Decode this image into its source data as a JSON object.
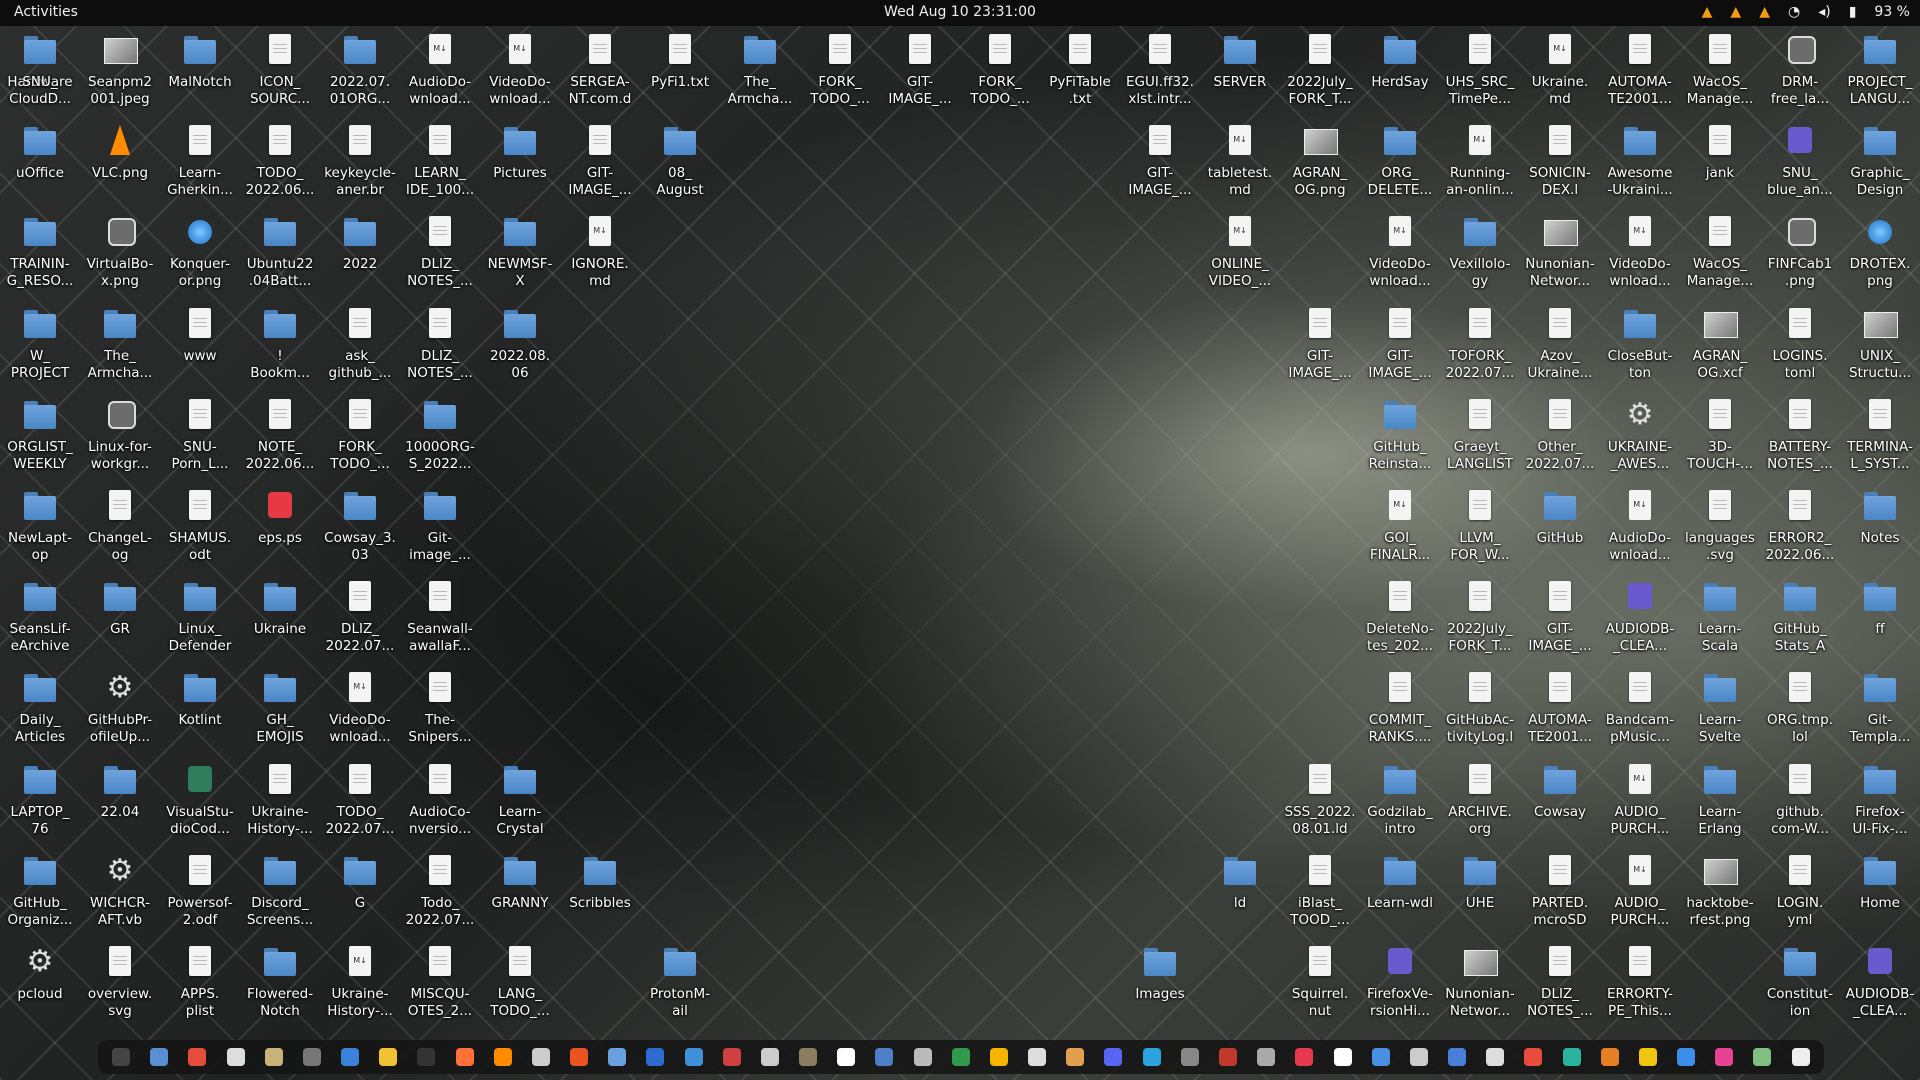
{
  "topbar": {
    "activities": "Activities",
    "clock": "Wed Aug 10  23:31:00",
    "battery": "93 %"
  },
  "desktop_icons": [
    {
      "label": "Hardware",
      "type": "folder"
    },
    {
      "label": "Seanpm2\n001.jpeg",
      "type": "image"
    },
    {
      "label": "MalNotch",
      "type": "folder"
    },
    {
      "label": "ICON_\nSOURC...",
      "type": "doc"
    },
    {
      "label": "2022.07.\n01ORG...",
      "type": "folder"
    },
    {
      "label": "AudioDo-\nwnload...",
      "type": "md"
    },
    {
      "label": "VideoDo-\nwnload...",
      "type": "md"
    },
    {
      "label": "SERGEA-\nNT.com.d",
      "type": "doc"
    },
    {
      "label": "PyFi1.txt",
      "type": "doc"
    },
    {
      "label": "The_\nArmcha...",
      "type": "folder"
    },
    {
      "label": "FORK_\nTODO_...",
      "type": "doc"
    },
    {
      "label": "GIT-\nIMAGE_...",
      "type": "doc"
    },
    {
      "label": "FORK_\nTODO_...",
      "type": "doc"
    },
    {
      "label": "PyFiTable\n.txt",
      "type": "doc"
    },
    {
      "label": "EGUI.ff32.\nxlst.intr...",
      "type": "doc"
    },
    {
      "label": "SERVER",
      "type": "folder"
    },
    {
      "label": "2022July_\nFORK_T...",
      "type": "doc"
    },
    {
      "label": "HerdSay",
      "type": "folder"
    },
    {
      "label": "UHS_SRC_\nTimePe...",
      "type": "doc"
    },
    {
      "label": "Ukraine.\nmd",
      "type": "md"
    },
    {
      "label": "AUTOMA-\nTE2001...",
      "type": "doc"
    },
    {
      "label": "WacOS_\nManage...",
      "type": "doc"
    },
    {
      "label": "DRM-\nfree_la...",
      "type": "app"
    },
    {
      "label": "PROJECT_\nLANGU...",
      "type": "folder"
    },
    {
      "label": "uOffice",
      "type": "folder"
    },
    {
      "label": "VLC.png",
      "type": "cone"
    },
    {
      "label": "Learn-\nGherkin...",
      "type": "doc"
    },
    {
      "label": "TODO_\n2022.06...",
      "type": "doc"
    },
    {
      "label": "keykeycle-\naner.br",
      "type": "doc"
    },
    {
      "label": "LEARN_\nIDE_100...",
      "type": "doc"
    },
    {
      "label": "Pictures",
      "type": "folder"
    },
    {
      "label": "GIT-\nIMAGE_...",
      "type": "doc"
    },
    {
      "label": "08_\nAugust",
      "type": "folder"
    },
    {
      "label": "GIT-\nIMAGE_...",
      "type": "doc"
    },
    {
      "label": "tabletest.\nmd",
      "type": "md"
    },
    {
      "label": "AGRAN_\nOG.png",
      "type": "image"
    },
    {
      "label": "ORG_\nDELETE...",
      "type": "folder"
    },
    {
      "label": "Running-\nan-onlin...",
      "type": "md"
    },
    {
      "label": "SONICIN-\nDEX.l",
      "type": "doc"
    },
    {
      "label": "Awesome\n-Ukraini...",
      "type": "folder"
    },
    {
      "label": "jank",
      "type": "doc"
    },
    {
      "label": "SNU_\nblue_an...",
      "type": "purple"
    },
    {
      "label": "Graphic_\nDesign",
      "type": "folder"
    },
    {
      "label": "TRAININ-\nG_RESO...",
      "type": "folder"
    },
    {
      "label": "VirtualBo-\nx.png",
      "type": "app"
    },
    {
      "label": "Konquer-\nor.png",
      "type": "web"
    },
    {
      "label": "Ubuntu22\n.04Batt...",
      "type": "folder"
    },
    {
      "label": "2022",
      "type": "folder"
    },
    {
      "label": "DLIZ_\nNOTES_...",
      "type": "doc"
    },
    {
      "label": "NEWMSF-\nX",
      "type": "folder"
    },
    {
      "label": "IGNORE.\nmd",
      "type": "md"
    },
    {
      "label": "ONLINE_\nVIDEO_...",
      "type": "md"
    },
    {
      "label": "VideoDo-\nwnload...",
      "type": "md"
    },
    {
      "label": "Vexillolo-\ngy",
      "type": "folder"
    },
    {
      "label": "Nunonian-\nNetwor...",
      "type": "image"
    },
    {
      "label": "VideoDo-\nwnload...",
      "type": "md"
    },
    {
      "label": "WacOS_\nManage...",
      "type": "doc"
    },
    {
      "label": "FINFCab1\n.png",
      "type": "app"
    },
    {
      "label": "DROTEX.\npng",
      "type": "web"
    },
    {
      "label": "W_\nPROJECT",
      "type": "folder"
    },
    {
      "label": "The_\nArmcha...",
      "type": "folder"
    },
    {
      "label": "www",
      "type": "doc"
    },
    {
      "label": "!\nBookm...",
      "type": "folder"
    },
    {
      "label": "ask_\ngithub_...",
      "type": "doc"
    },
    {
      "label": "DLIZ_\nNOTES_...",
      "type": "doc"
    },
    {
      "label": "2022.08.\n06",
      "type": "folder"
    },
    {
      "label": "GIT-\nIMAGE_...",
      "type": "doc"
    },
    {
      "label": "GIT-\nIMAGE_...",
      "type": "doc"
    },
    {
      "label": "TOFORK_\n2022.07...",
      "type": "doc"
    },
    {
      "label": "Azov_\nUkraine...",
      "type": "doc"
    },
    {
      "label": "CloseBut-\nton",
      "type": "folder"
    },
    {
      "label": "AGRAN_\nOG.xcf",
      "type": "image"
    },
    {
      "label": "LOGINS.\ntoml",
      "type": "doc"
    },
    {
      "label": "UNIX_\nStructu...",
      "type": "image"
    },
    {
      "label": "ORGLIST_\nWEEKLY",
      "type": "folder"
    },
    {
      "label": "Linux-for-\nworkgr...",
      "type": "app"
    },
    {
      "label": "SNU-\nPorn_L...",
      "type": "doc"
    },
    {
      "label": "NOTE_\n2022.06...",
      "type": "doc"
    },
    {
      "label": "FORK_\nTODO_...",
      "type": "doc"
    },
    {
      "label": "1000ORG-\nS_2022...",
      "type": "folder"
    },
    {
      "label": "GitHub_\nReinsta...",
      "type": "folder"
    },
    {
      "label": "Graeyt_\nLANGLIST",
      "type": "doc"
    },
    {
      "label": "Other_\n2022.07...",
      "type": "doc"
    },
    {
      "label": "UKRAINE-\n_AWES...",
      "type": "gear"
    },
    {
      "label": "3D-\nTOUCH-...",
      "type": "doc"
    },
    {
      "label": "BATTERY-\nNOTES_...",
      "type": "doc"
    },
    {
      "label": "TERMINA-\nL_SYST...",
      "type": "doc"
    },
    {
      "label": "NewLapt-\nop",
      "type": "folder"
    },
    {
      "label": "ChangeL-\nog",
      "type": "doc"
    },
    {
      "label": "SHAMUS.\nodt",
      "type": "doc"
    },
    {
      "label": "eps.ps",
      "type": "red"
    },
    {
      "label": "Cowsay_3.\n03",
      "type": "folder"
    },
    {
      "label": "Git-\nimage_...",
      "type": "folder"
    },
    {
      "label": "GOI_\nFINALR...",
      "type": "md"
    },
    {
      "label": "LLVM_\nFOR_W...",
      "type": "doc"
    },
    {
      "label": "GitHub",
      "type": "folder"
    },
    {
      "label": "AudioDo-\nwnload...",
      "type": "md"
    },
    {
      "label": "languages\n.svg",
      "type": "doc"
    },
    {
      "label": "ERROR2_\n2022.06...",
      "type": "doc"
    },
    {
      "label": "Notes",
      "type": "folder"
    },
    {
      "label": "SeansLif-\neArchive",
      "type": "folder"
    },
    {
      "label": "GR",
      "type": "folder"
    },
    {
      "label": "Linux_\nDefender",
      "type": "folder"
    },
    {
      "label": "Ukraine",
      "type": "folder"
    },
    {
      "label": "DLIZ_\n2022.07...",
      "type": "doc"
    },
    {
      "label": "Seanwall-\nawallaF...",
      "type": "doc"
    },
    {
      "label": "DeleteNo-\ntes_202...",
      "type": "doc"
    },
    {
      "label": "2022July_\nFORK_T...",
      "type": "doc"
    },
    {
      "label": "GIT-\nIMAGE_...",
      "type": "doc"
    },
    {
      "label": "AUDIODB-\n_CLEA...",
      "type": "purple"
    },
    {
      "label": "Learn-\nScala",
      "type": "folder"
    },
    {
      "label": "GitHub_\nStats_A",
      "type": "folder"
    },
    {
      "label": "ff",
      "type": "folder"
    },
    {
      "label": "Daily_\nArticles",
      "type": "folder"
    },
    {
      "label": "GitHubPr-\nofileUp...",
      "type": "gear"
    },
    {
      "label": "Kotlint",
      "type": "folder"
    },
    {
      "label": "GH_\nEMOJIS",
      "type": "folder"
    },
    {
      "label": "VideoDo-\nwnload...",
      "type": "md"
    },
    {
      "label": "The-\nSnipers...",
      "type": "doc"
    },
    {
      "label": "COMMIT_\nRANKS....",
      "type": "doc"
    },
    {
      "label": "GitHubAc-\ntivityLog.l",
      "type": "doc"
    },
    {
      "label": "AUTOMA-\nTE2001...",
      "type": "doc"
    },
    {
      "label": "Bandcam-\npMusic...",
      "type": "doc"
    },
    {
      "label": "Learn-\nSvelte",
      "type": "folder"
    },
    {
      "label": "ORG.tmp.\nlol",
      "type": "doc"
    },
    {
      "label": "Git-\nTempla...",
      "type": "folder"
    },
    {
      "label": "LAPTOP_\n76",
      "type": "folder"
    },
    {
      "label": "22.04",
      "type": "folder"
    },
    {
      "label": "VisualStu-\ndioCod...",
      "type": "green"
    },
    {
      "label": "Ukraine-\nHistory-...",
      "type": "doc"
    },
    {
      "label": "TODO_\n2022.07...",
      "type": "doc"
    },
    {
      "label": "AudioCo-\nnversio...",
      "type": "doc"
    },
    {
      "label": "Learn-\nCrystal",
      "type": "folder"
    },
    {
      "label": "SSS_2022.\n08.01.ld",
      "type": "doc"
    },
    {
      "label": "Godzilab_\nintro",
      "type": "folder"
    },
    {
      "label": "ARCHIVE.\norg",
      "type": "doc"
    },
    {
      "label": "Cowsay",
      "type": "folder"
    },
    {
      "label": "AUDIO_\nPURCH...",
      "type": "md"
    },
    {
      "label": "Learn-\nErlang",
      "type": "folder"
    },
    {
      "label": "github.\ncom-W...",
      "type": "doc"
    },
    {
      "label": "Firefox-\nUI-Fix-...",
      "type": "folder"
    },
    {
      "label": "GitHub_\nOrganiz...",
      "type": "folder"
    },
    {
      "label": "WICHCR-\nAFT.vb",
      "type": "gear"
    },
    {
      "label": "Powersof-\n2.odf",
      "type": "doc"
    },
    {
      "label": "Discord_\nScreens...",
      "type": "folder"
    },
    {
      "label": "G",
      "type": "folder"
    },
    {
      "label": "Todo_\n2022.07...",
      "type": "doc"
    },
    {
      "label": "GRANNY",
      "type": "folder"
    },
    {
      "label": "Scribbles",
      "type": "folder"
    },
    {
      "label": "ld",
      "type": "folder"
    },
    {
      "label": "iBlast_\nTOOD_...",
      "type": "doc"
    },
    {
      "label": "Learn-wdl",
      "type": "folder"
    },
    {
      "label": "UHE",
      "type": "folder"
    },
    {
      "label": "PARTED.\nmcroSD",
      "type": "doc"
    },
    {
      "label": "AUDIO_\nPURCH...",
      "type": "md"
    },
    {
      "label": "hacktobe-\nrfest.png",
      "type": "image"
    },
    {
      "label": "LOGIN.\nyml",
      "type": "doc"
    },
    {
      "label": "Home",
      "type": "folder"
    },
    {
      "label": "pcloud",
      "type": "gear"
    },
    {
      "label": "overview.\nsvg",
      "type": "doc"
    },
    {
      "label": "APPS.\nplist",
      "type": "doc"
    },
    {
      "label": "Flowered-\nNotch",
      "type": "folder"
    },
    {
      "label": "Ukraine-\nHistory-...",
      "type": "md"
    },
    {
      "label": "MISCQU-\nOTES_2...",
      "type": "doc"
    },
    {
      "label": "LANG_\nTODO_...",
      "type": "doc"
    },
    {
      "label": "ProtonM-\nail",
      "type": "folder"
    },
    {
      "label": "Images",
      "type": "folder"
    },
    {
      "label": "Squirrel.\nnut",
      "type": "doc"
    },
    {
      "label": "FirefoxVe-\nrsionHi...",
      "type": "purple"
    },
    {
      "label": "Nunonian-\nNetwor...",
      "type": "image"
    },
    {
      "label": "DLIZ_\nNOTES_...",
      "type": "doc"
    },
    {
      "label": "ERRORTY-\nPE_This...",
      "type": "doc"
    },
    {
      "label": "Constitut-\nion",
      "type": "folder"
    },
    {
      "label": "AUDIODB-\n_CLEA...",
      "type": "purple"
    },
    {
      "label": "SNU_\nCloudD...",
      "type": "folder"
    }
  ],
  "dock_apps": [
    {
      "name": "terminal-app",
      "color": "#444"
    },
    {
      "name": "files-app",
      "color": "#5b8fd3"
    },
    {
      "name": "chrome-app",
      "color": "#e44d3a"
    },
    {
      "name": "notes-app",
      "color": "#dddddd"
    },
    {
      "name": "text-editor-app",
      "color": "#c9b27a"
    },
    {
      "name": "screenshot-app",
      "color": "#777"
    },
    {
      "name": "writer-app",
      "color": "#3a82d7"
    },
    {
      "name": "calc-app",
      "color": "#f1c232"
    },
    {
      "name": "terminal2-app",
      "color": "#333"
    },
    {
      "name": "firefox-app",
      "color": "#ff7139"
    },
    {
      "name": "vlc-app",
      "color": "#ff8c00"
    },
    {
      "name": "obs-app",
      "color": "#ccc"
    },
    {
      "name": "store-app",
      "color": "#e95420"
    },
    {
      "name": "draw-app",
      "color": "#6aa0e0"
    },
    {
      "name": "docs-app",
      "color": "#2e6bd1"
    },
    {
      "name": "help-app",
      "color": "#3f8fd9"
    },
    {
      "name": "monitor-app",
      "color": "#d04040"
    },
    {
      "name": "github-app",
      "color": "#ccc"
    },
    {
      "name": "gimp-app",
      "color": "#8a7d60"
    },
    {
      "name": "inkscape-app",
      "color": "#fff"
    },
    {
      "name": "virtualbox-app",
      "color": "#4d7fc9"
    },
    {
      "name": "obs2-app",
      "color": "#bbb"
    },
    {
      "name": "sheets-app",
      "color": "#2f9a4a"
    },
    {
      "name": "slides-app",
      "color": "#f4b400"
    },
    {
      "name": "pdf-app",
      "color": "#ddd"
    },
    {
      "name": "archive-app",
      "color": "#e0a050"
    },
    {
      "name": "discord-app",
      "color": "#5865f2"
    },
    {
      "name": "telegram-app",
      "color": "#2aa3df"
    },
    {
      "name": "audio-app",
      "color": "#888"
    },
    {
      "name": "reader-app",
      "color": "#c0392b"
    },
    {
      "name": "percent-app",
      "color": "#aaa"
    },
    {
      "name": "media-app",
      "color": "#e63950"
    },
    {
      "name": "calendar-app",
      "color": "#fff"
    },
    {
      "name": "writer2-app",
      "color": "#4a90e2"
    },
    {
      "name": "steam-app",
      "color": "#ccc"
    },
    {
      "name": "chromium-app",
      "color": "#4a7fd8"
    },
    {
      "name": "camera-app",
      "color": "#ddd"
    },
    {
      "name": "heart-app",
      "color": "#e74c3c"
    },
    {
      "name": "teal-app",
      "color": "#2bb3a0"
    },
    {
      "name": "game-app",
      "color": "#e67e22"
    },
    {
      "name": "chat-app",
      "color": "#f1c40f"
    },
    {
      "name": "vscode-app",
      "color": "#3b8eea"
    },
    {
      "name": "music-app",
      "color": "#e84393"
    },
    {
      "name": "trash-app",
      "color": "#7fbf7f"
    },
    {
      "name": "app-grid",
      "color": "#eeeeee"
    }
  ]
}
